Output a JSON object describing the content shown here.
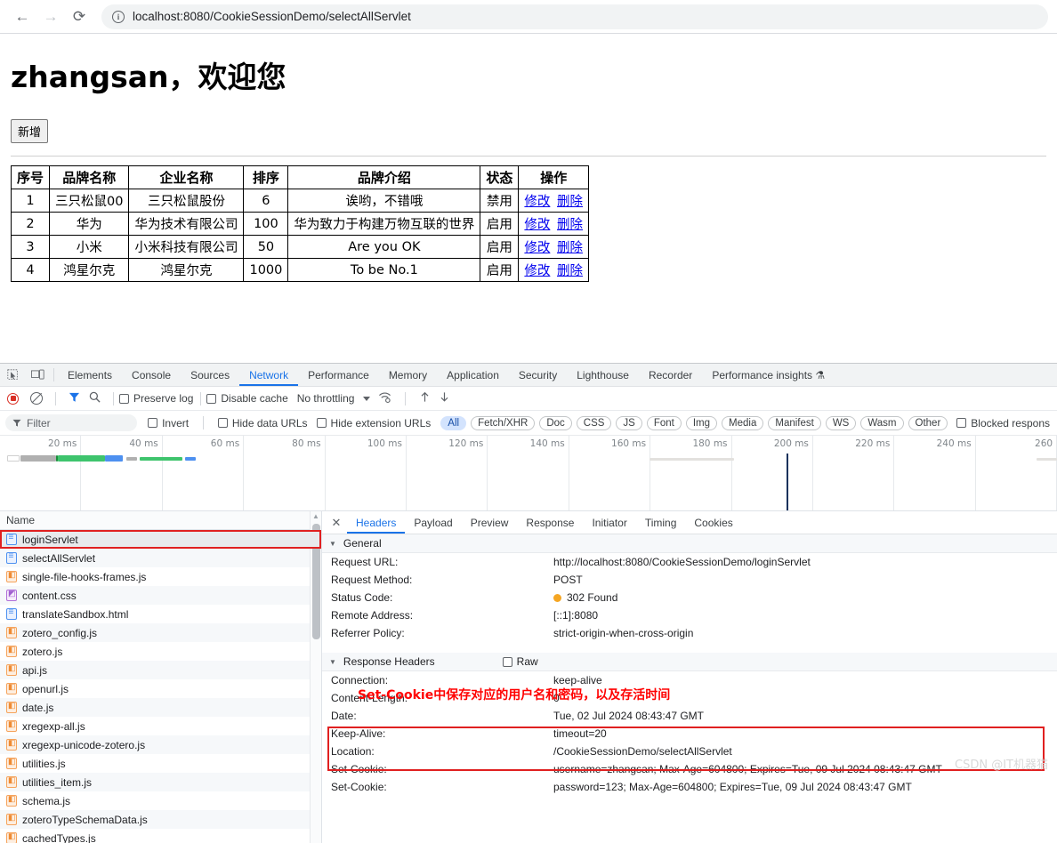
{
  "browser": {
    "back_icon": "←",
    "forward_icon": "→",
    "reload_icon": "⟳",
    "site_info_icon": "i",
    "url": "localhost:8080/CookieSessionDemo/selectAllServlet"
  },
  "page": {
    "heading": "zhangsan，欢迎您",
    "add_button": "新增",
    "table": {
      "headers": [
        "序号",
        "品牌名称",
        "企业名称",
        "排序",
        "品牌介绍",
        "状态",
        "操作"
      ],
      "rows": [
        {
          "id": "1",
          "brand": "三只松鼠00",
          "company": "三只松鼠股份",
          "order": "6",
          "desc": "诶哟，不错哦",
          "status": "禁用",
          "edit": "修改",
          "del": "删除"
        },
        {
          "id": "2",
          "brand": "华为",
          "company": "华为技术有限公司",
          "order": "100",
          "desc": "华为致力于构建万物互联的世界",
          "status": "启用",
          "edit": "修改",
          "del": "删除"
        },
        {
          "id": "3",
          "brand": "小米",
          "company": "小米科技有限公司",
          "order": "50",
          "desc": "Are you OK",
          "status": "启用",
          "edit": "修改",
          "del": "删除"
        },
        {
          "id": "4",
          "brand": "鸿星尔克",
          "company": "鸿星尔克",
          "order": "1000",
          "desc": "To be No.1",
          "status": "启用",
          "edit": "修改",
          "del": "删除"
        }
      ]
    }
  },
  "devtools": {
    "panel_tabs": [
      {
        "label": "Elements",
        "active": false
      },
      {
        "label": "Console",
        "active": false
      },
      {
        "label": "Sources",
        "active": false
      },
      {
        "label": "Network",
        "active": true
      },
      {
        "label": "Performance",
        "active": false
      },
      {
        "label": "Memory",
        "active": false
      },
      {
        "label": "Application",
        "active": false
      },
      {
        "label": "Security",
        "active": false
      },
      {
        "label": "Lighthouse",
        "active": false
      },
      {
        "label": "Recorder",
        "active": false
      },
      {
        "label": "Performance insights ⚗",
        "active": false
      }
    ],
    "toolbar": {
      "record_title": "record",
      "clear_title": "clear",
      "filter_title": "filter",
      "search_title": "search",
      "preserve_log": "Preserve log",
      "disable_cache": "Disable cache",
      "throttling": "No throttling",
      "import_title": "import-har",
      "export_title": "export-har"
    },
    "filterbar": {
      "filter_placeholder": "Filter",
      "invert": "Invert",
      "hide_data_urls": "Hide data URLs",
      "hide_extension_urls": "Hide extension URLs",
      "types": [
        "All",
        "Fetch/XHR",
        "Doc",
        "CSS",
        "JS",
        "Font",
        "Img",
        "Media",
        "Manifest",
        "WS",
        "Wasm",
        "Other"
      ],
      "selected_type": "All",
      "blocked_responses": "Blocked respons"
    },
    "overview": {
      "ticks": [
        "20 ms",
        "40 ms",
        "60 ms",
        "80 ms",
        "100 ms",
        "120 ms",
        "140 ms",
        "160 ms",
        "180 ms",
        "200 ms",
        "220 ms",
        "240 ms",
        "260"
      ]
    },
    "requests": {
      "column_header": "Name",
      "items": [
        {
          "name": "loginServlet",
          "type": "doc",
          "selected": true
        },
        {
          "name": "selectAllServlet",
          "type": "doc",
          "selected": false
        },
        {
          "name": "single-file-hooks-frames.js",
          "type": "js",
          "selected": false
        },
        {
          "name": "content.css",
          "type": "css",
          "selected": false
        },
        {
          "name": "translateSandbox.html",
          "type": "doc",
          "selected": false
        },
        {
          "name": "zotero_config.js",
          "type": "js",
          "selected": false
        },
        {
          "name": "zotero.js",
          "type": "js",
          "selected": false
        },
        {
          "name": "api.js",
          "type": "js",
          "selected": false
        },
        {
          "name": "openurl.js",
          "type": "js",
          "selected": false
        },
        {
          "name": "date.js",
          "type": "js",
          "selected": false
        },
        {
          "name": "xregexp-all.js",
          "type": "js",
          "selected": false
        },
        {
          "name": "xregexp-unicode-zotero.js",
          "type": "js",
          "selected": false
        },
        {
          "name": "utilities.js",
          "type": "js",
          "selected": false
        },
        {
          "name": "utilities_item.js",
          "type": "js",
          "selected": false
        },
        {
          "name": "schema.js",
          "type": "js",
          "selected": false
        },
        {
          "name": "zoteroTypeSchemaData.js",
          "type": "js",
          "selected": false
        },
        {
          "name": "cachedTypes.js",
          "type": "js",
          "selected": false
        }
      ]
    },
    "detail": {
      "close_icon": "✕",
      "tabs": [
        {
          "label": "Headers",
          "active": true
        },
        {
          "label": "Payload",
          "active": false
        },
        {
          "label": "Preview",
          "active": false
        },
        {
          "label": "Response",
          "active": false
        },
        {
          "label": "Initiator",
          "active": false
        },
        {
          "label": "Timing",
          "active": false
        },
        {
          "label": "Cookies",
          "active": false
        }
      ],
      "general": {
        "title": "General",
        "rows": [
          {
            "key": "Request URL:",
            "value": "http://localhost:8080/CookieSessionDemo/loginServlet"
          },
          {
            "key": "Request Method:",
            "value": "POST"
          },
          {
            "key": "Status Code:",
            "value": "302 Found",
            "status_dot": "#f5a623"
          },
          {
            "key": "Remote Address:",
            "value": "[::1]:8080"
          },
          {
            "key": "Referrer Policy:",
            "value": "strict-origin-when-cross-origin"
          }
        ]
      },
      "response_headers": {
        "title": "Response Headers",
        "raw_label": "Raw",
        "rows": [
          {
            "key": "Connection:",
            "value": "keep-alive"
          },
          {
            "key": "Content-Length:",
            "value": "0"
          },
          {
            "key": "Date:",
            "value": "Tue, 02 Jul 2024 08:43:47 GMT"
          },
          {
            "key": "Keep-Alive:",
            "value": "timeout=20"
          },
          {
            "key": "Location:",
            "value": "/CookieSessionDemo/selectAllServlet"
          },
          {
            "key": "Set-Cookie:",
            "value": "username=zhangsan; Max-Age=604800; Expires=Tue, 09 Jul 2024 08:43:47 GMT"
          },
          {
            "key": "Set-Cookie:",
            "value": "password=123; Max-Age=604800; Expires=Tue, 09 Jul 2024 08:43:47 GMT"
          }
        ]
      }
    }
  },
  "annotations": {
    "cookie_note": "Set-Cookie中保存对应的用户名和密码，以及存活时间",
    "watermark": "CSDN @IT机器猫"
  },
  "colors": {
    "accent": "#1a73e8",
    "annotation_red": "#ff0000",
    "status_orange": "#f5a623",
    "link_blue": "#0000ee"
  }
}
